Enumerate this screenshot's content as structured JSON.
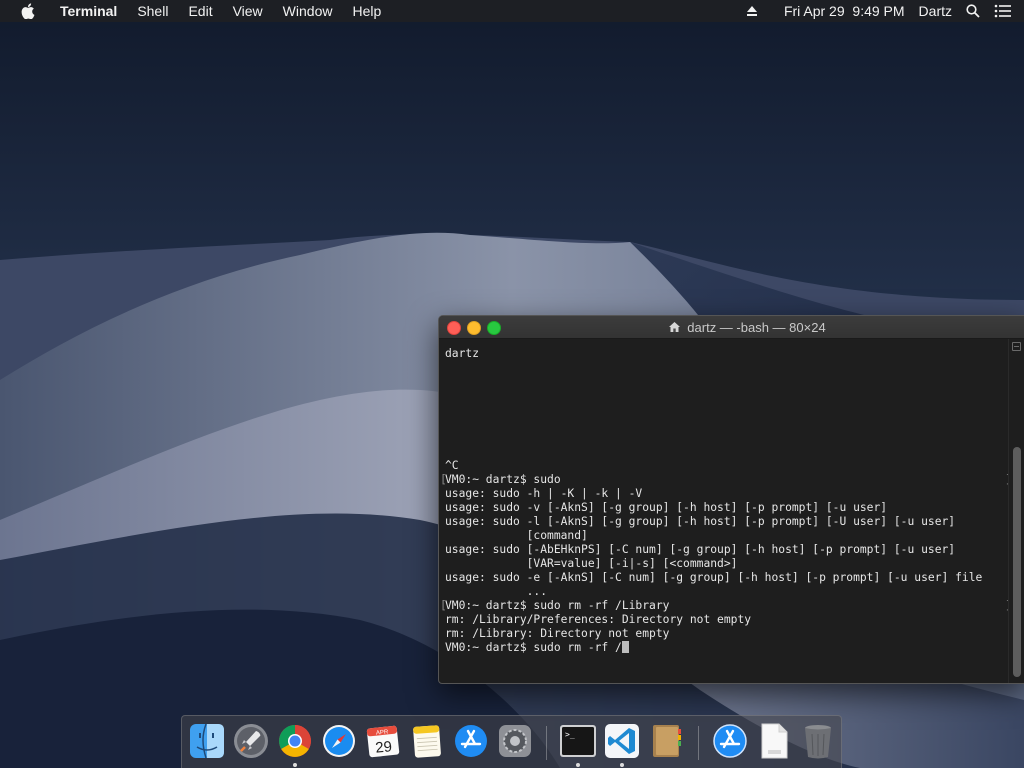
{
  "menubar": {
    "app_name": "Terminal",
    "menus": [
      "Shell",
      "Edit",
      "View",
      "Window",
      "Help"
    ],
    "clock": "Fri Apr 29  9:49 PM",
    "user": "Dartz"
  },
  "terminal": {
    "title": "dartz — -bash — 80×24",
    "lines": [
      {
        "text": "dartz",
        "marks": false
      },
      {
        "text": "",
        "marks": false
      },
      {
        "text": "",
        "marks": false
      },
      {
        "text": "",
        "marks": false
      },
      {
        "text": "",
        "marks": false
      },
      {
        "text": "",
        "marks": false
      },
      {
        "text": "",
        "marks": false
      },
      {
        "text": "",
        "marks": false
      },
      {
        "text": "^C",
        "marks": false
      },
      {
        "text": "VM0:~ dartz$ sudo",
        "marks": true
      },
      {
        "text": "usage: sudo -h | -K | -k | -V",
        "marks": false
      },
      {
        "text": "usage: sudo -v [-AknS] [-g group] [-h host] [-p prompt] [-u user]",
        "marks": false
      },
      {
        "text": "usage: sudo -l [-AknS] [-g group] [-h host] [-p prompt] [-U user] [-u user]",
        "marks": false
      },
      {
        "text": "            [command]",
        "marks": false
      },
      {
        "text": "usage: sudo [-AbEHknPS] [-C num] [-g group] [-h host] [-p prompt] [-u user]",
        "marks": false
      },
      {
        "text": "            [VAR=value] [-i|-s] [<command>]",
        "marks": false
      },
      {
        "text": "usage: sudo -e [-AknS] [-C num] [-g group] [-h host] [-p prompt] [-u user] file",
        "marks": false
      },
      {
        "text": "            ...",
        "marks": false
      },
      {
        "text": "VM0:~ dartz$ sudo rm -rf /Library",
        "marks": true
      },
      {
        "text": "rm: /Library/Preferences: Directory not empty",
        "marks": false
      },
      {
        "text": "rm: /Library: Directory not empty",
        "marks": false
      },
      {
        "text": "VM0:~ dartz$ sudo rm -rf /",
        "marks": false,
        "cursor": true
      }
    ]
  },
  "dock": {
    "calendar_month": "APR",
    "calendar_day": "29",
    "apps": [
      {
        "name": "finder",
        "running": false
      },
      {
        "name": "launchpad",
        "running": false
      },
      {
        "name": "chrome",
        "running": true
      },
      {
        "name": "safari",
        "running": false
      },
      {
        "name": "calendar",
        "running": false
      },
      {
        "name": "notes",
        "running": false
      },
      {
        "name": "app-store",
        "running": false
      },
      {
        "name": "system-preferences",
        "running": false
      },
      {
        "name": "terminal",
        "running": true
      },
      {
        "name": "vscode",
        "running": true
      },
      {
        "name": "contacts",
        "running": false
      },
      {
        "name": "app-store-downloads",
        "running": false
      },
      {
        "name": "text-document",
        "running": false
      },
      {
        "name": "trash",
        "running": false
      }
    ]
  }
}
